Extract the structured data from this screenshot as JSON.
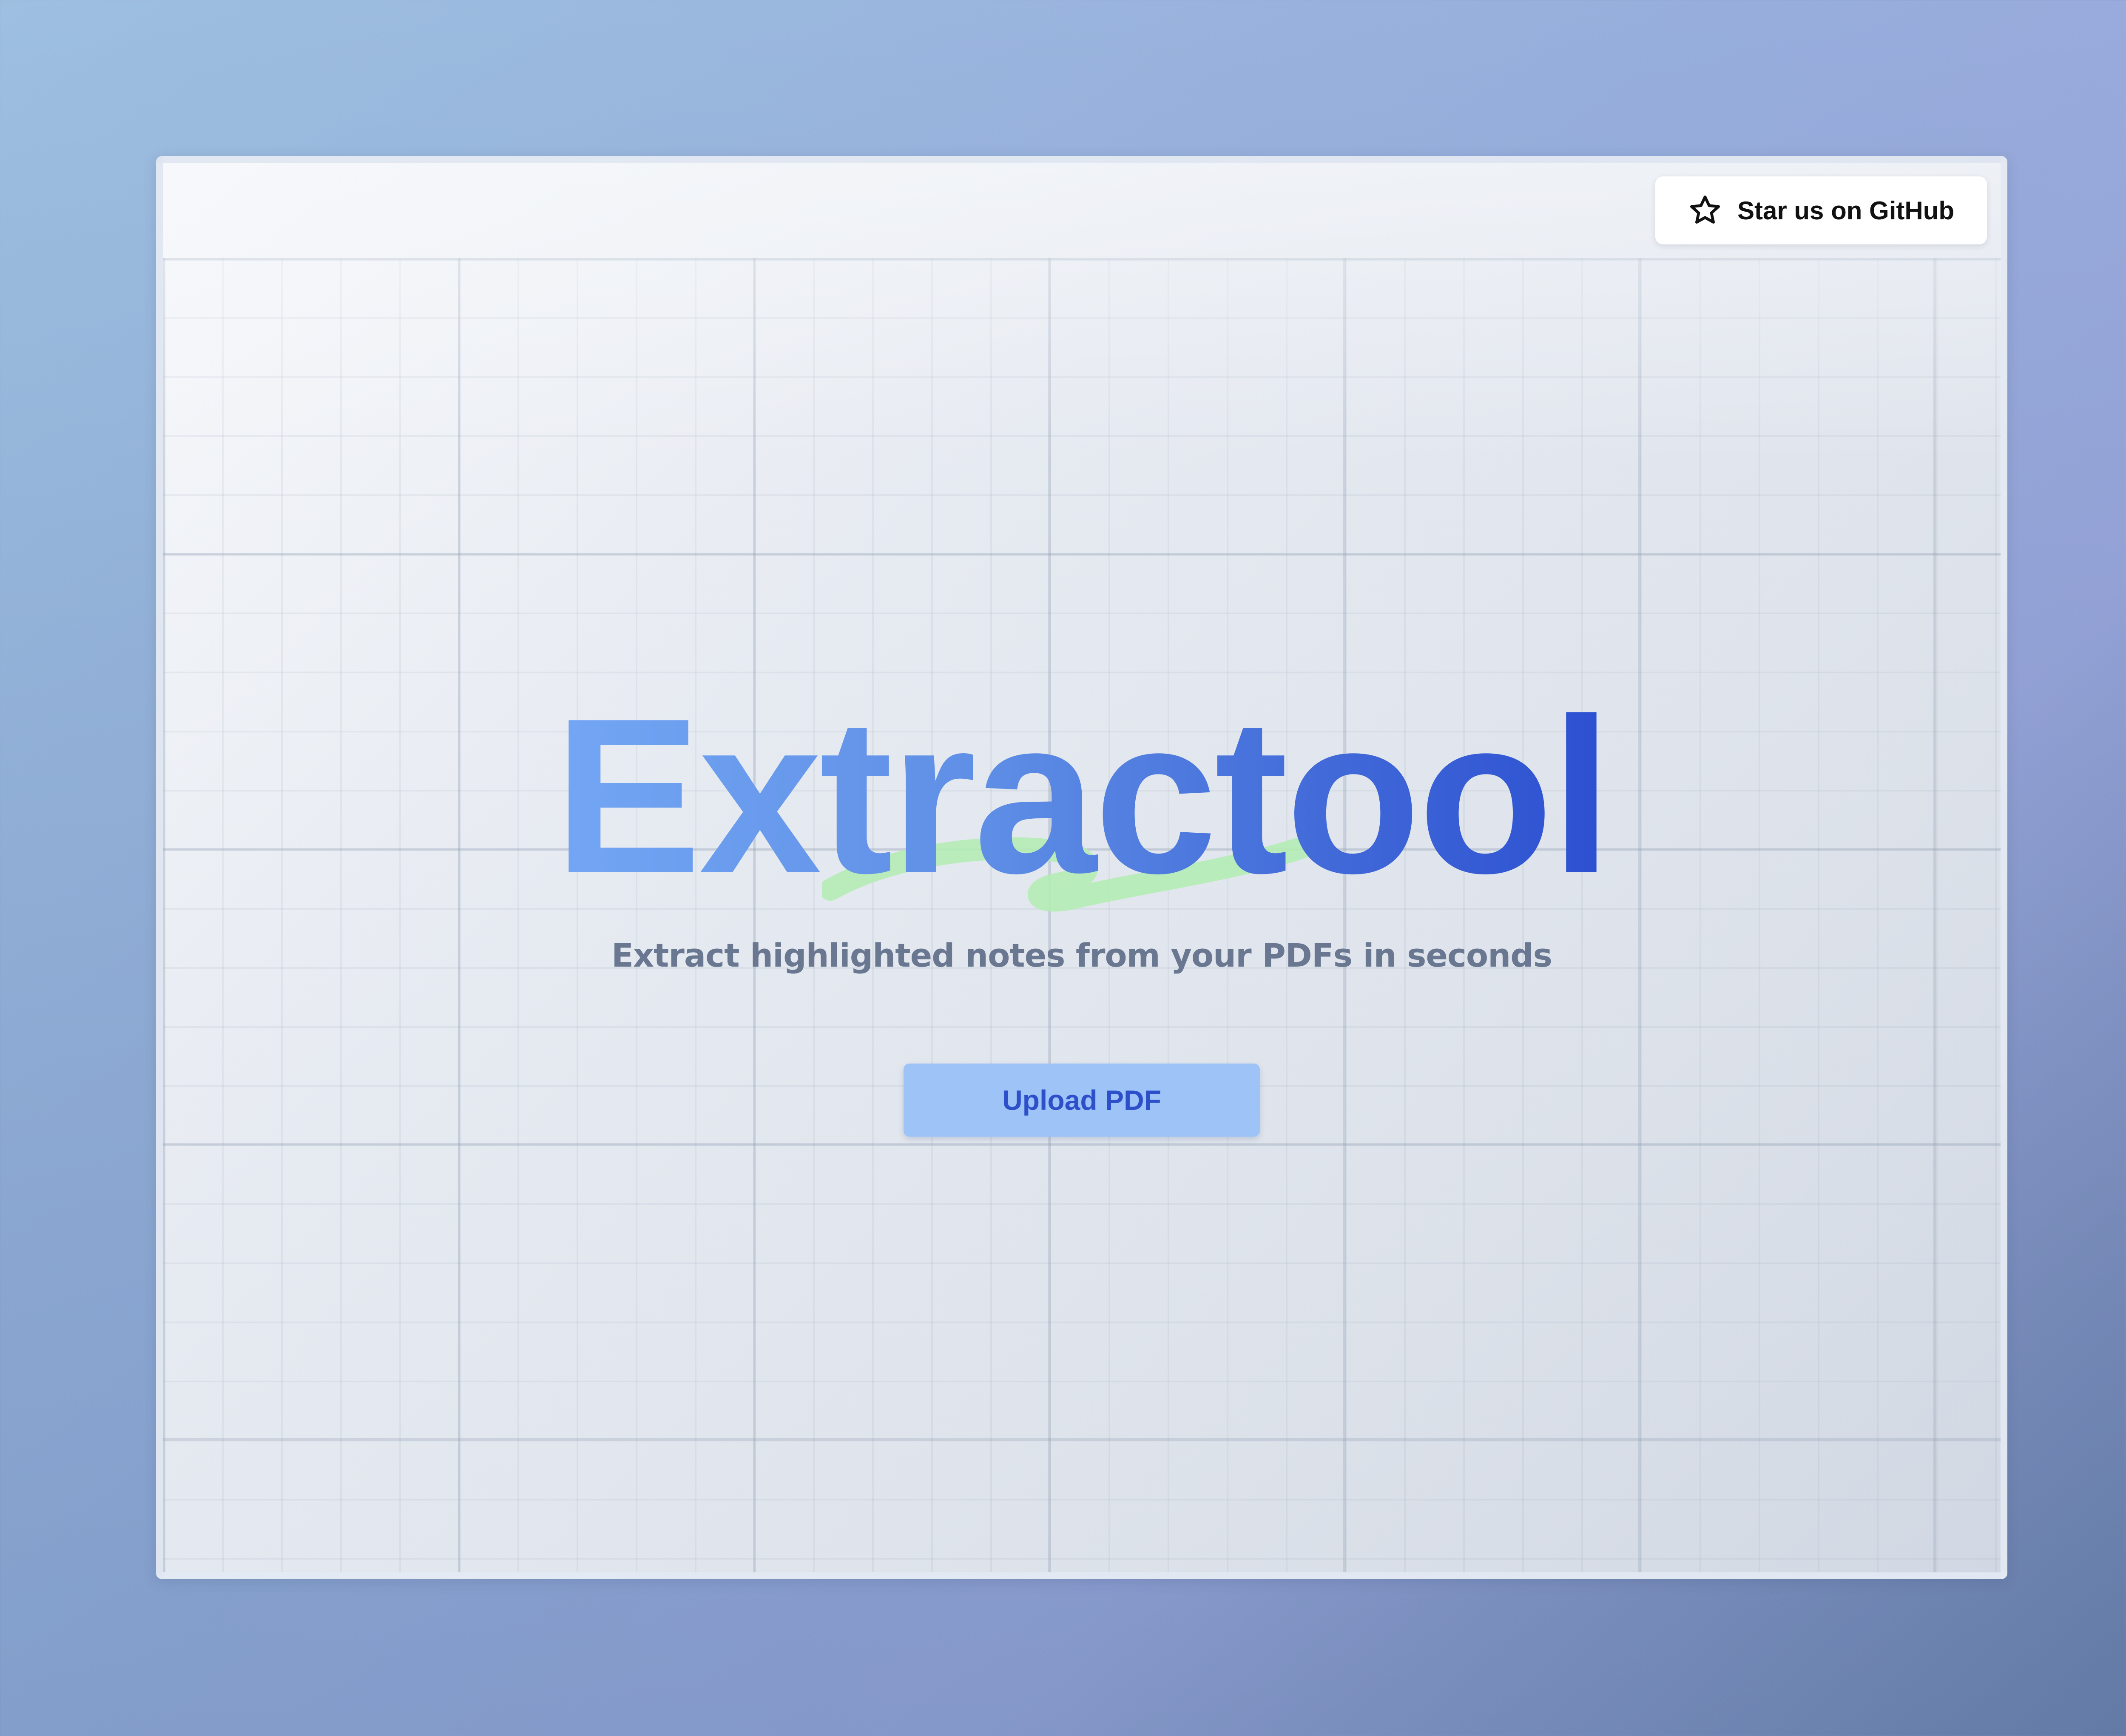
{
  "github": {
    "label": "Star us on GitHub",
    "icon": "star-icon"
  },
  "hero": {
    "title": "Extractool",
    "subtitle": "Extract highlighted notes from your PDFs in seconds"
  },
  "upload": {
    "label": "Upload PDF"
  },
  "colors": {
    "title_gradient_start": "#73a6f4",
    "title_gradient_end": "#2c4fd1",
    "highlight_stroke": "#b5ecb5",
    "upload_button_bg": "#9ec3f6",
    "upload_button_text": "#2d4fc9",
    "subtitle_text": "#6a7791"
  }
}
